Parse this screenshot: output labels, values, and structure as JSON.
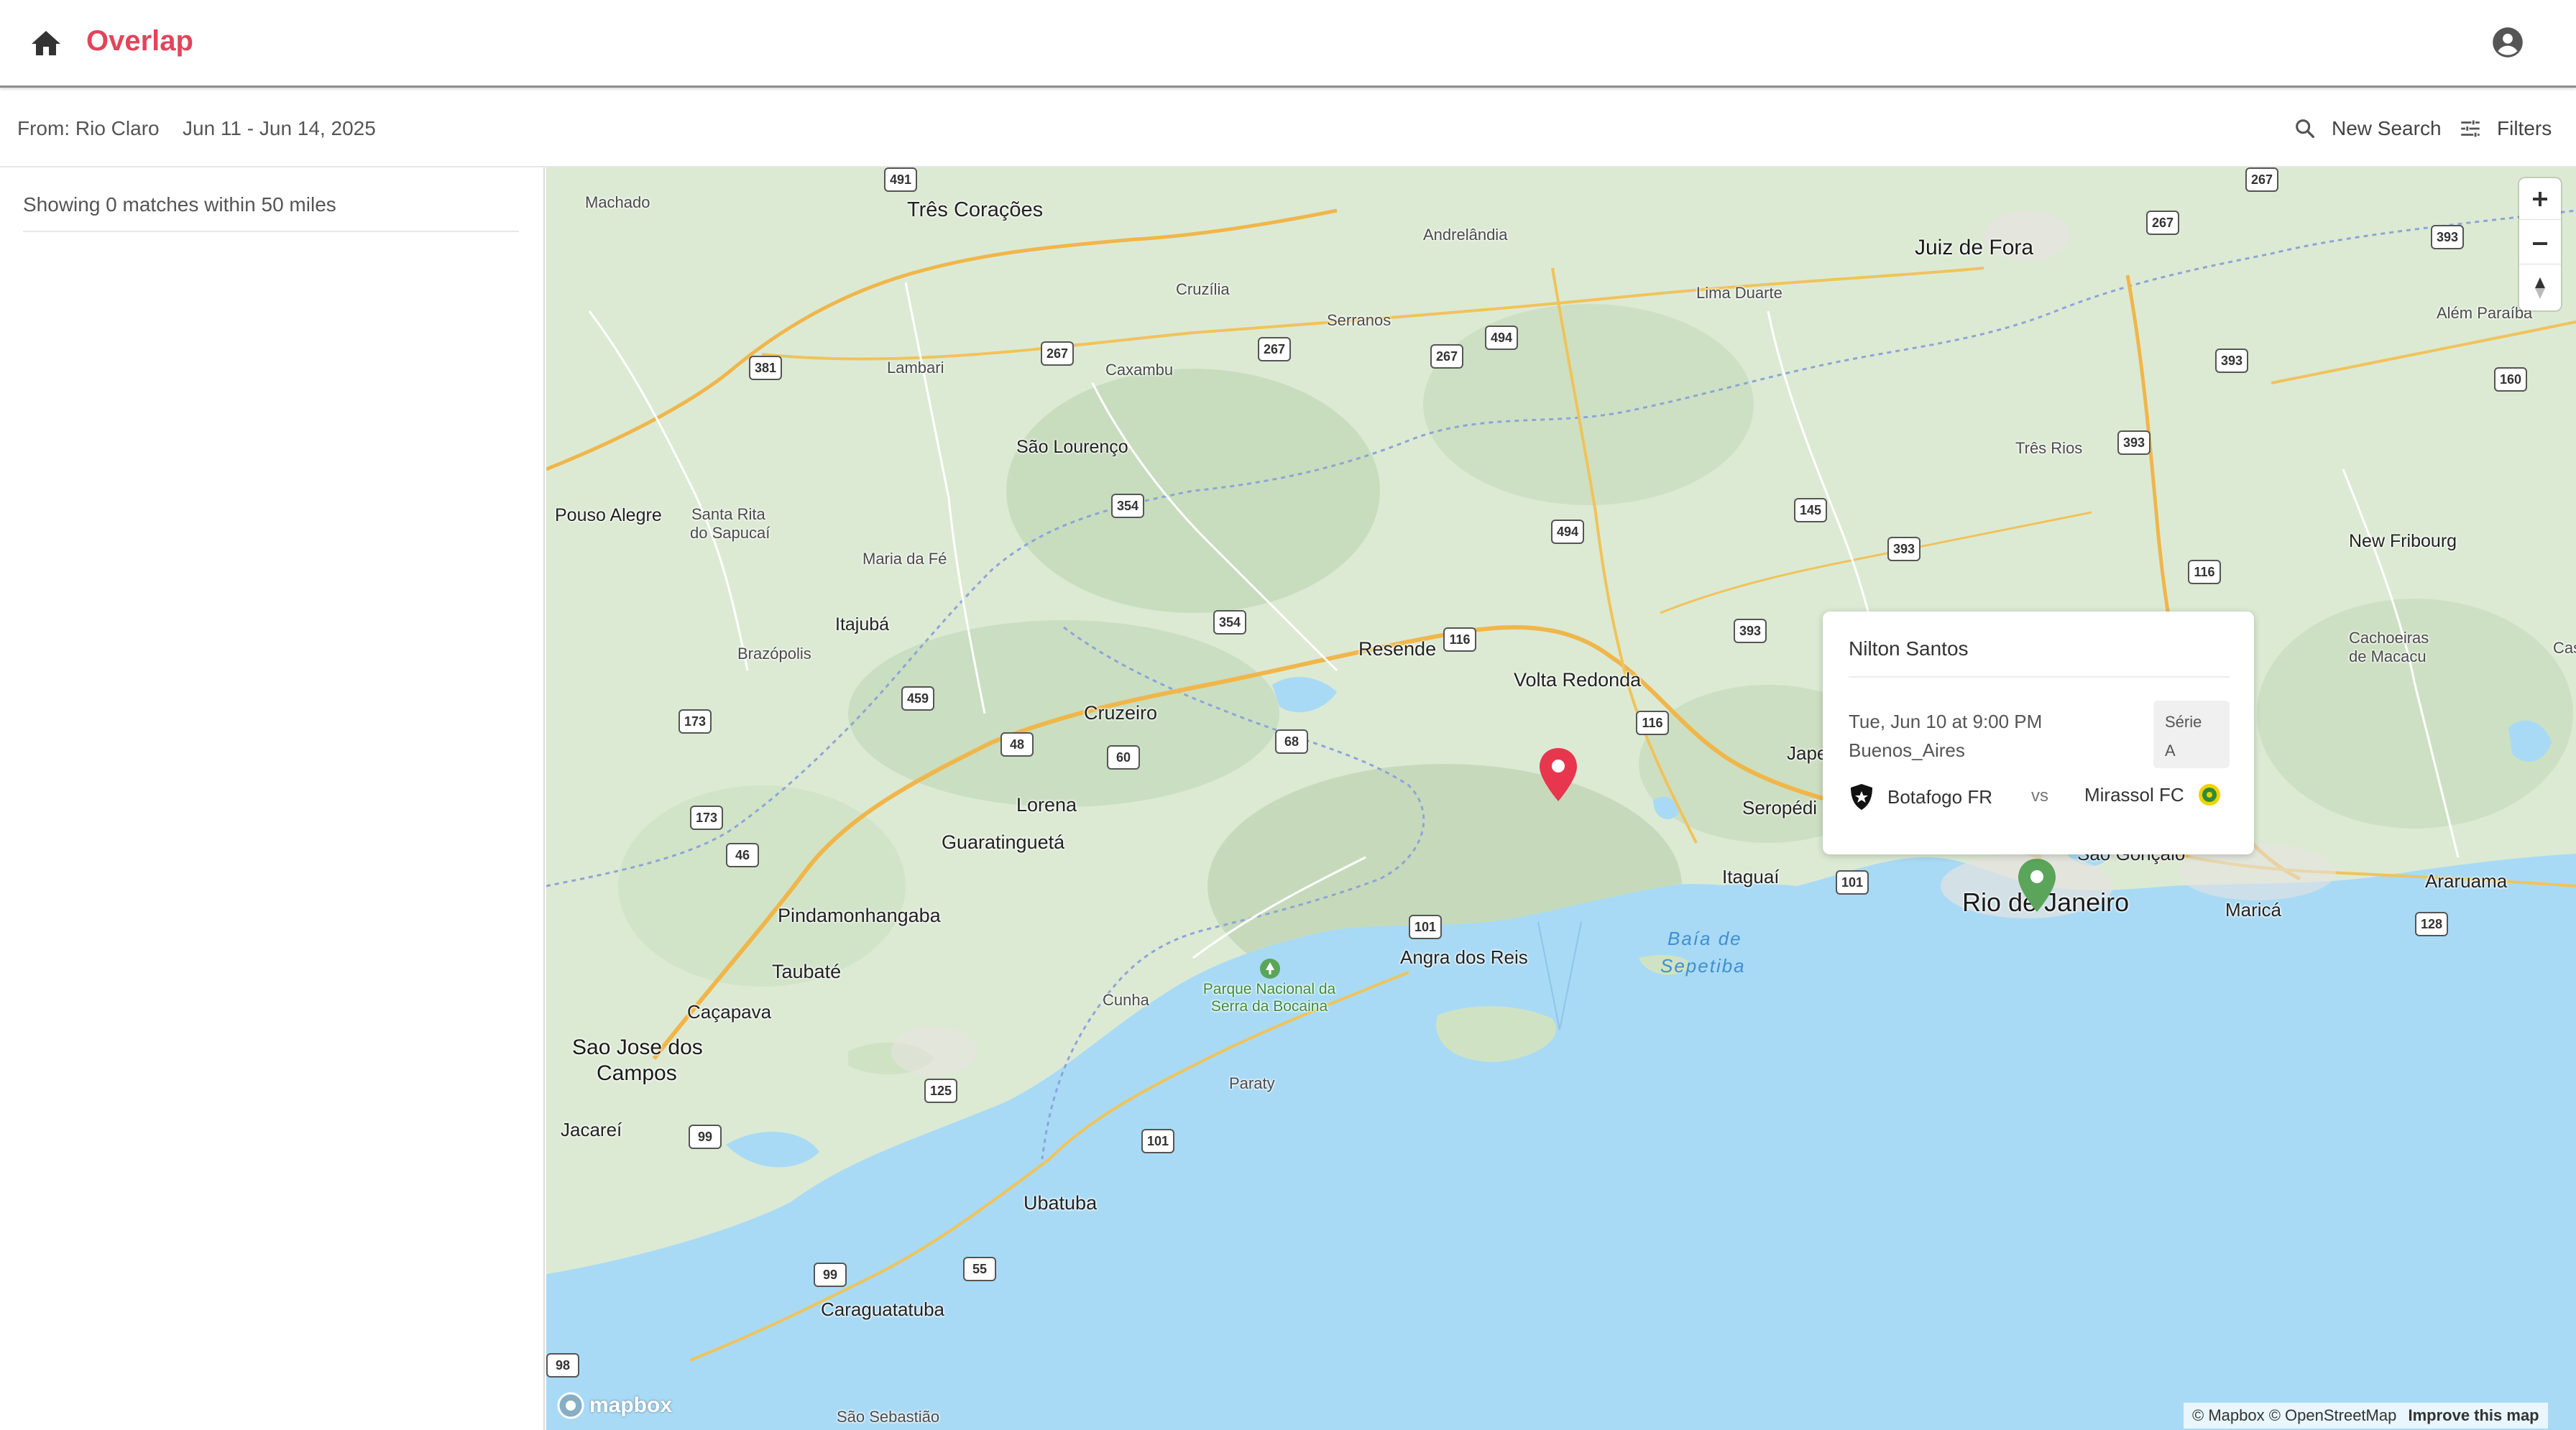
{
  "app": {
    "brand": "Overlap"
  },
  "search": {
    "from": "From: Rio Claro",
    "dates": "Jun 11 - Jun 14, 2025",
    "new_search_label": "New Search",
    "filters_label": "Filters"
  },
  "results": {
    "summary": "Showing 0 matches within 50 miles"
  },
  "popup": {
    "venue": "Nilton Santos",
    "datetime": "Tue, Jun 10 at 9:00 PM",
    "timezone": "Buenos_Aires",
    "league_line1": "Série",
    "league_line2": "A",
    "home_team": "Botafogo FR",
    "vs": "vs",
    "away_team": "Mirassol FC"
  },
  "map": {
    "attribution_text": "© Mapbox © OpenStreetMap",
    "improve_label": "Improve this map",
    "logo_text": "mapbox",
    "places": {
      "machado": "Machado",
      "tres_coracoes": "Três Corações",
      "andrelandia": "Andrelândia",
      "juiz_de_fora": "Juiz de Fora",
      "cruzilia": "Cruzília",
      "serranos": "Serranos",
      "lima_duarte": "Lima Duarte",
      "alem_paraiba": "Além Paraíba",
      "lambari": "Lambari",
      "caxambu": "Caxambu",
      "sao_lourenco": "São Lourenço",
      "tres_rios": "Três Rios",
      "pouso_alegre": "Pouso Alegre",
      "santa_rita_1": "Santa Rita",
      "santa_rita_2": "do Sapucaí",
      "maria_da_fe": "Maria da Fé",
      "new_fribourg": "New Fribourg",
      "itajuba": "Itajubá",
      "resende": "Resende",
      "volta_redonda": "Volta Redonda",
      "brazopolis": "Brazópolis",
      "cruzeiro": "Cruzeiro",
      "cachoeiras_1": "Cachoeiras",
      "cachoeiras_2": "de Macacu",
      "cas": "Cas",
      "jape": "Jape",
      "lorena": "Lorena",
      "seropedi": "Seropédi",
      "ai": "aí",
      "guaratingueta": "Guaratinguetá",
      "itaguai": "Itaguaí",
      "sao_goncalo": "São Gonçalo",
      "pindamonhangaba": "Pindamonhangaba",
      "rio_de_janeiro": "Rio de Janeiro",
      "marica": "Maricá",
      "araruama": "Araruama",
      "angra": "Angra dos Reis",
      "baia_1": "Baía de",
      "baia_2": "Sepetiba",
      "taubate": "Taubaté",
      "parque": "Parque Nacional da Serra da Bocaina",
      "cunha": "Cunha",
      "cacapava": "Caçapava",
      "sjc_1": "Sao Jose dos",
      "sjc_2": "Campos",
      "paraty": "Paraty",
      "jacarei": "Jacareí",
      "ubatuba": "Ubatuba",
      "caraguatatuba": "Caraguatatuba",
      "sao_sebastiao": "São Sebastião"
    },
    "shields": {
      "s491": "491",
      "s267a": "267",
      "s267b": "267",
      "s267c": "267",
      "s267d": "267",
      "s267e": "267",
      "s393a": "393",
      "s393b": "393",
      "s393c": "393",
      "s393d": "393",
      "s393e": "393",
      "s381": "381",
      "s494a": "494",
      "s494b": "494",
      "s160": "160",
      "s354a": "354",
      "s354b": "354",
      "s145": "145",
      "s116a": "116",
      "s116b": "116",
      "s116c": "116",
      "s459": "459",
      "s173a": "173",
      "s173b": "173",
      "s48": "48",
      "s60": "60",
      "s68": "68",
      "s46": "46",
      "s101a": "101",
      "s101b": "101",
      "s101c": "101",
      "s128": "128",
      "s125": "125",
      "s99a": "99",
      "s99b": "99",
      "s55": "55",
      "s98": "98"
    }
  },
  "colors": {
    "brand": "#e2445c",
    "selected_pin": "#e8364f",
    "venue_pin": "#5aa55a",
    "water": "#a8daf5",
    "land": "#dcead4"
  }
}
